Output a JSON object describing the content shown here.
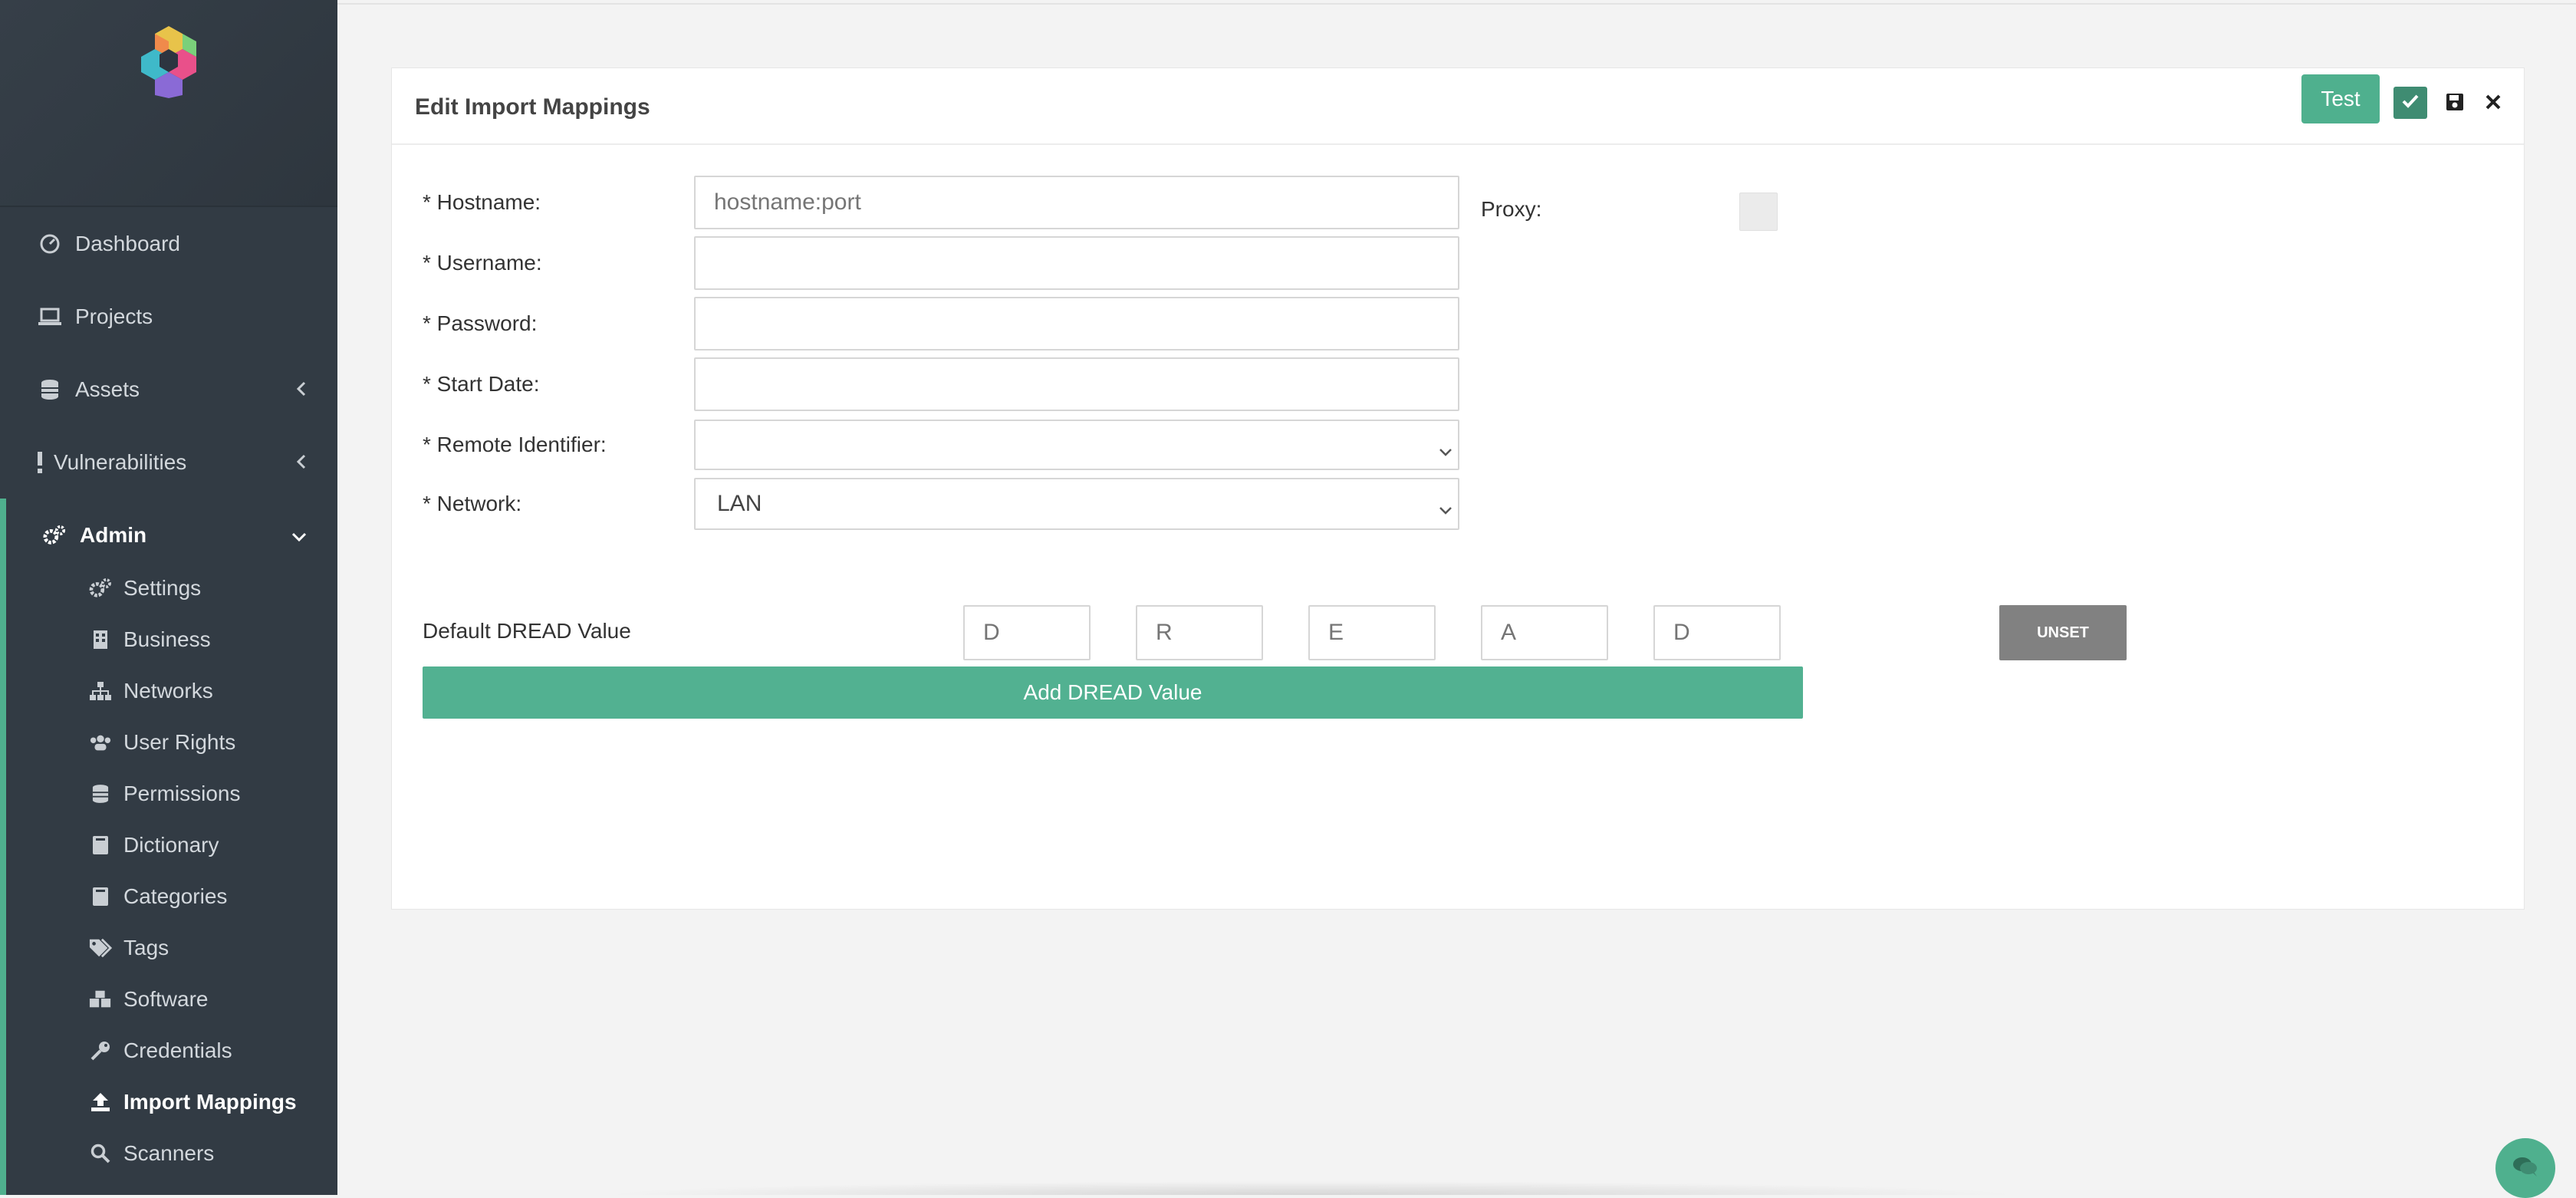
{
  "sidebar": {
    "items": [
      {
        "label": "Dashboard",
        "icon": "dashboard-icon"
      },
      {
        "label": "Projects",
        "icon": "laptop-icon"
      },
      {
        "label": "Assets",
        "icon": "database-icon"
      },
      {
        "label": "Vulnerabilities",
        "icon": "exclamation-icon"
      },
      {
        "label": "Admin",
        "icon": "cogs-icon"
      }
    ],
    "admin_items": [
      {
        "label": "Settings",
        "icon": "cogs-icon"
      },
      {
        "label": "Business",
        "icon": "building-icon"
      },
      {
        "label": "Networks",
        "icon": "sitemap-icon"
      },
      {
        "label": "User Rights",
        "icon": "users-icon"
      },
      {
        "label": "Permissions",
        "icon": "database-icon"
      },
      {
        "label": "Dictionary",
        "icon": "book-icon"
      },
      {
        "label": "Categories",
        "icon": "book-icon"
      },
      {
        "label": "Tags",
        "icon": "tags-icon"
      },
      {
        "label": "Software",
        "icon": "cubes-icon"
      },
      {
        "label": "Credentials",
        "icon": "key-icon"
      },
      {
        "label": "Import Mappings",
        "icon": "upload-icon"
      },
      {
        "label": "Scanners",
        "icon": "search-icon"
      }
    ],
    "active_item": "Import Mappings"
  },
  "card": {
    "title": "Edit Import Mappings",
    "test_label": "Test"
  },
  "form": {
    "hostname_label": "* Hostname:",
    "hostname_placeholder": "hostname:port",
    "username_label": "* Username:",
    "password_label": "* Password:",
    "start_date_label": "* Start Date:",
    "remote_identifier_label": "* Remote Identifier:",
    "remote_identifier_value": "",
    "network_label": "* Network:",
    "network_value": "LAN",
    "proxy_label": "Proxy:"
  },
  "dread": {
    "label": "Default DREAD Value",
    "placeholders": [
      "D",
      "R",
      "E",
      "A",
      "D"
    ],
    "unset_label": "UNSET",
    "add_label": "Add DREAD Value"
  },
  "colors": {
    "accent": "#4fb08e",
    "sidebar_bg": "#323b44",
    "unset_bg": "#818181"
  }
}
